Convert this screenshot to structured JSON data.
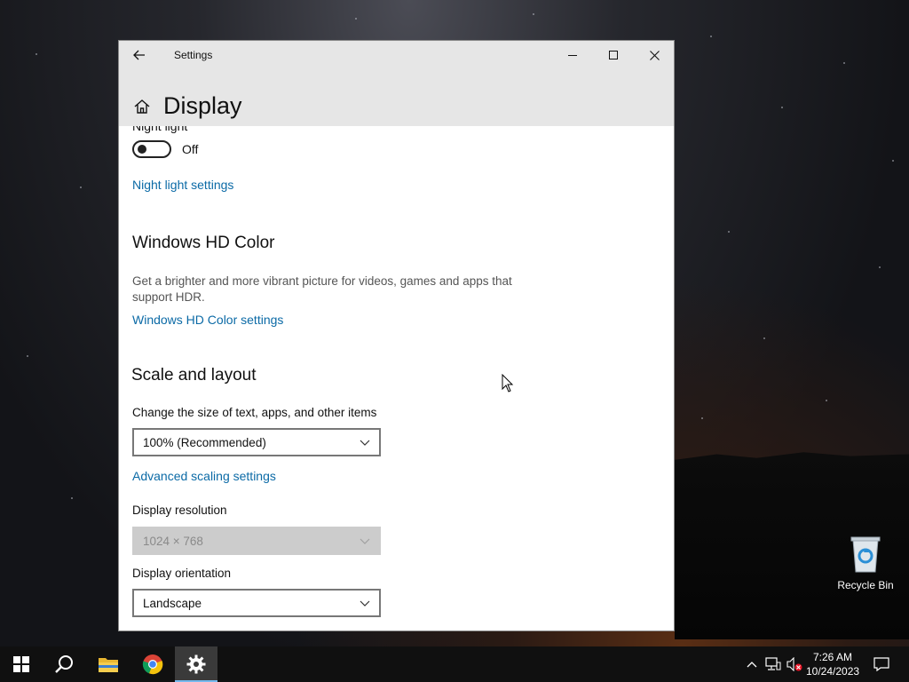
{
  "window": {
    "app_title": "Settings",
    "page_title": "Display"
  },
  "night_light": {
    "heading": "Night light",
    "toggle_state": "Off",
    "settings_link": "Night light settings"
  },
  "hd_color": {
    "title": "Windows HD Color",
    "description": "Get a brighter and more vibrant picture for videos, games and apps that support HDR.",
    "settings_link": "Windows HD Color settings"
  },
  "scale_layout": {
    "title": "Scale and layout",
    "scale_label": "Change the size of text, apps, and other items",
    "scale_value": "100% (Recommended)",
    "advanced_link": "Advanced scaling settings",
    "resolution_label": "Display resolution",
    "resolution_value": "1024 × 768",
    "orientation_label": "Display orientation",
    "orientation_value": "Landscape"
  },
  "desktop": {
    "recycle_bin_label": "Recycle Bin"
  },
  "taskbar": {
    "time": "7:26 AM",
    "date": "10/24/2023",
    "pinned": [
      "start-icon",
      "search-icon",
      "file-explorer-icon",
      "chrome-icon",
      "settings-gear-icon"
    ]
  },
  "colors": {
    "accent_link": "#0b6aa6",
    "titlebar": "#e6e6e6",
    "taskbar": "#101010",
    "active_indicator": "#76b9ed"
  }
}
